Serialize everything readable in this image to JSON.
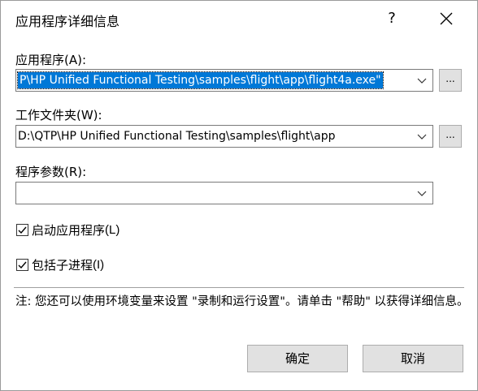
{
  "dialog": {
    "title": "应用程序详细信息",
    "help_glyph": "?",
    "app_label": "应用程序(A):",
    "app_path": "P\\HP Unified Functional Testing\\samples\\flight\\app\\flight4a.exe\"",
    "workdir_label": "工作文件夹(W):",
    "workdir_path": "D:\\QTP\\HP Unified Functional Testing\\samples\\flight\\app",
    "args_label": "程序参数(R):",
    "args_value": "",
    "browse_label": "...",
    "launch_label": "启动应用程序",
    "launch_key": "(L)",
    "launch_checked": true,
    "children_label": "包括子进程",
    "children_key": "(I)",
    "children_checked": true,
    "note": "注: 您还可以使用环境变量来设置 \"录制和运行设置\"。请单击 \"帮助\" 以获得详细信息。",
    "ok_label": "确定",
    "cancel_label": "取消"
  },
  "icons": [
    "close-icon",
    "chevron-down-icon",
    "checkmark-icon"
  ]
}
